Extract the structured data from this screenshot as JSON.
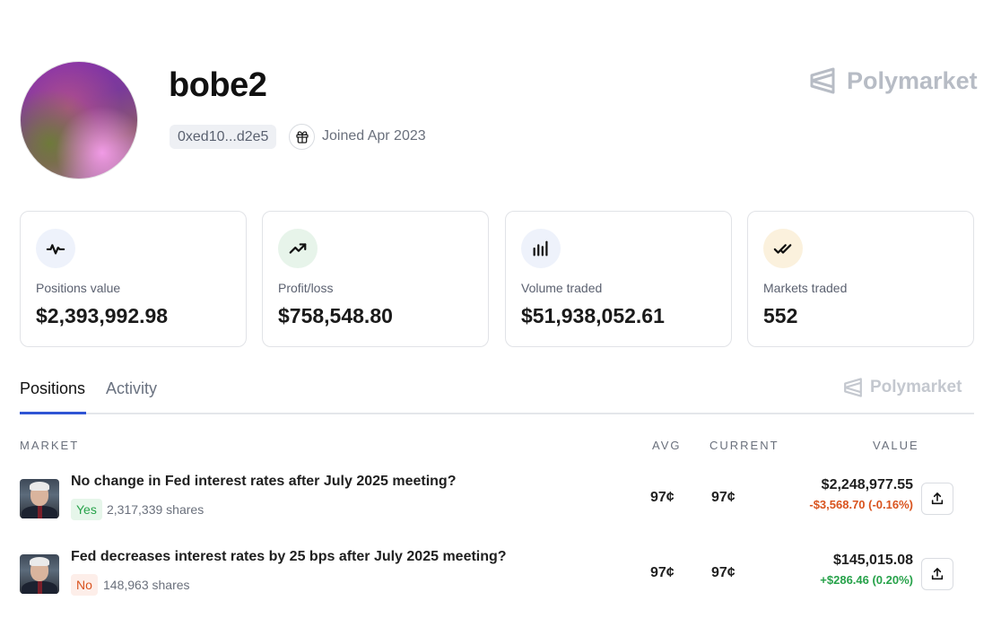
{
  "brand": {
    "name": "Polymarket"
  },
  "profile": {
    "username": "bobe2",
    "address": "0xed10...d2e5",
    "joined": "Joined Apr 2023"
  },
  "stats": [
    {
      "label": "Positions value",
      "value": "$2,393,992.98",
      "icon": "activity-icon",
      "bg": "#eef2fb"
    },
    {
      "label": "Profit/loss",
      "value": "$758,548.80",
      "icon": "trending-up-icon",
      "bg": "#e7f4ea"
    },
    {
      "label": "Volume traded",
      "value": "$51,938,052.61",
      "icon": "bar-chart-icon",
      "bg": "#eef2fb"
    },
    {
      "label": "Markets traded",
      "value": "552",
      "icon": "double-check-icon",
      "bg": "#fbf1dd"
    }
  ],
  "tabs": [
    {
      "label": "Positions",
      "active": true
    },
    {
      "label": "Activity",
      "active": false
    }
  ],
  "table": {
    "headers": {
      "market": "MARKET",
      "avg": "AVG",
      "current": "CURRENT",
      "value": "VALUE"
    },
    "rows": [
      {
        "title": "No change in Fed interest rates after July 2025 meeting?",
        "outcome": "Yes",
        "shares": "2,317,339 shares",
        "avg": "97¢",
        "current": "97¢",
        "value": "$2,248,977.55",
        "change": "-$3,568.70 (-0.16%)"
      },
      {
        "title": "Fed decreases interest rates by 25 bps after July 2025 meeting?",
        "outcome": "No",
        "shares": "148,963 shares",
        "avg": "97¢",
        "current": "97¢",
        "value": "$145,015.08",
        "change": "+$286.46 (0.20%)"
      }
    ]
  },
  "colors": {
    "accent": "#2f55d4",
    "positive": "#27a24a",
    "negative": "#d9531e"
  }
}
